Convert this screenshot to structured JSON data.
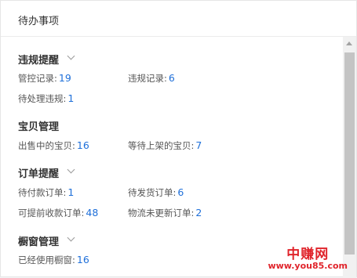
{
  "panel": {
    "title": "待办事项"
  },
  "sections": [
    {
      "title": "违规提醒",
      "has_toggle": true,
      "items": [
        {
          "label": "管控记录:",
          "value": "19"
        },
        {
          "label": "违规记录:",
          "value": "6"
        },
        {
          "label": "待处理违规:",
          "value": "1"
        }
      ]
    },
    {
      "title": "宝贝管理",
      "has_toggle": false,
      "items": [
        {
          "label": "出售中的宝贝:",
          "value": "16"
        },
        {
          "label": "等待上架的宝贝:",
          "value": "7"
        }
      ]
    },
    {
      "title": "订单提醒",
      "has_toggle": true,
      "items": [
        {
          "label": "待付款订单:",
          "value": "1"
        },
        {
          "label": "待发货订单:",
          "value": "6"
        },
        {
          "label": "可提前收款订单:",
          "value": "48"
        },
        {
          "label": "物流未更新订单:",
          "value": "2"
        }
      ]
    },
    {
      "title": "橱窗管理",
      "has_toggle": true,
      "items": [
        {
          "label": "已经使用橱窗:",
          "value": "16"
        }
      ]
    }
  ],
  "watermark": {
    "text": "中赚网",
    "url": "www.you85.com"
  },
  "colors": {
    "value": "#1e6fd9",
    "watermark": "#e0242b"
  },
  "icons": {
    "toggle": "chevron-down-icon"
  }
}
